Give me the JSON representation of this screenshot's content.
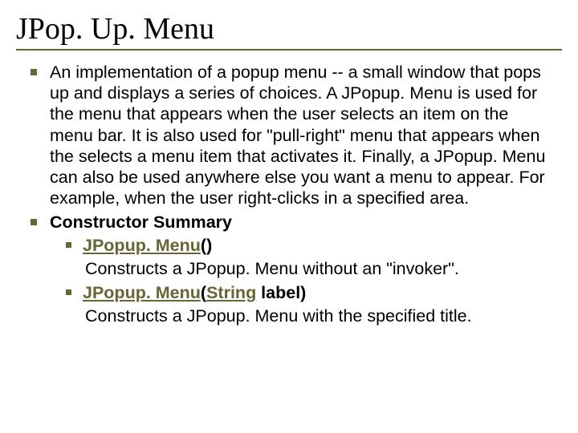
{
  "title": "JPop. Up. Menu",
  "bullets": [
    {
      "text": "An implementation of a popup menu -- a small window that pops up and displays a series of choices. A JPopup. Menu is used for the menu that appears when the user selects an item on the menu bar. It is also used for \"pull-right\" menu that appears when the selects a menu item that activates it. Finally, a JPopup. Menu can also be used anywhere else you want a menu to appear. For example, when the user right-clicks in a specified area."
    },
    {
      "bold": true,
      "text": "Constructor Summary"
    }
  ],
  "constructors": [
    {
      "sig_link": "JPopup. Menu",
      "sig_rest": "()",
      "desc": "Constructs a JPopup. Menu without an \"invoker\"."
    },
    {
      "sig_link": "JPopup. Menu",
      "sig_mid": "(",
      "sig_param_link": "String",
      "sig_after": " label)",
      "desc": "Constructs a JPopup. Menu with the specified title."
    }
  ]
}
